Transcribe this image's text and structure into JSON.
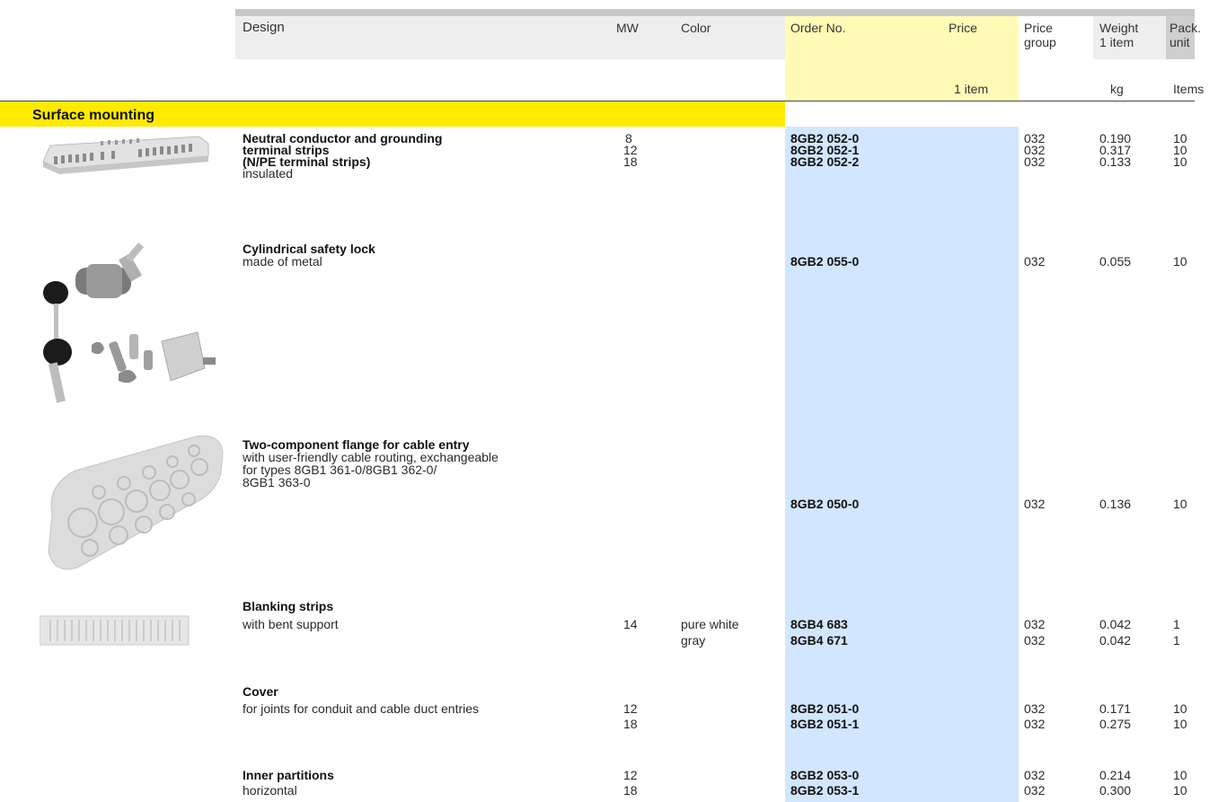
{
  "header": {
    "design": "Design",
    "mw": "MW",
    "color": "Color",
    "order_no": "Order No.",
    "price": "Price",
    "price_unit": "1 item",
    "price_group_1": "Price",
    "price_group_2": "group",
    "weight_1": "Weight",
    "weight_2": "1 item",
    "weight_unit": "kg",
    "pack_1": "Pack.",
    "pack_2": "unit",
    "pack_unit": "Items"
  },
  "section": {
    "title": "Surface mounting"
  },
  "products": [
    {
      "title_lines": [
        "Neutral conductor and grounding",
        "terminal strips",
        "(N/PE terminal strips)"
      ],
      "desc_lines": [
        "insulated"
      ],
      "image": "terminal-strip-image",
      "rows": [
        {
          "mw": "8",
          "color": "",
          "order": "8GB2 052-0",
          "group": "032",
          "weight": "0.190",
          "pack": "10"
        },
        {
          "mw": "12",
          "color": "",
          "order": "8GB2 052-1",
          "group": "032",
          "weight": "0.317",
          "pack": "10"
        },
        {
          "mw": "18",
          "color": "",
          "order": "8GB2 052-2",
          "group": "032",
          "weight": "0.133",
          "pack": "10"
        }
      ]
    },
    {
      "title_lines": [
        "Cylindrical safety lock"
      ],
      "desc_lines": [
        "made of metal"
      ],
      "image": "safety-lock-image",
      "rows": [
        {
          "mw": "",
          "color": "",
          "order": "8GB2 055-0",
          "group": "032",
          "weight": "0.055",
          "pack": "10"
        }
      ]
    },
    {
      "title_lines": [
        "Two-component flange for cable entry"
      ],
      "desc_lines": [
        "with user-friendly cable routing, exchangeable",
        "for types 8GB1 361-0/8GB1 362-0/",
        "8GB1 363-0"
      ],
      "image": "flange-image",
      "rows": [
        {
          "mw": "",
          "color": "",
          "order": "8GB2 050-0",
          "group": "032",
          "weight": "0.136",
          "pack": "10"
        }
      ]
    },
    {
      "title_lines": [
        "Blanking strips"
      ],
      "desc_lines": [
        "with bent support"
      ],
      "image": "blanking-strip-image",
      "rows": [
        {
          "mw": "14",
          "color": "pure white",
          "order": "8GB4 683",
          "group": "032",
          "weight": "0.042",
          "pack": "1"
        },
        {
          "mw": "",
          "color": "gray",
          "order": "8GB4 671",
          "group": "032",
          "weight": "0.042",
          "pack": "1"
        }
      ]
    },
    {
      "title_lines": [
        "Cover"
      ],
      "desc_lines": [
        "for joints for conduit and cable duct entries"
      ],
      "rows": [
        {
          "mw": "12",
          "color": "",
          "order": "8GB2 051-0",
          "group": "032",
          "weight": "0.171",
          "pack": "10"
        },
        {
          "mw": "18",
          "color": "",
          "order": "8GB2 051-1",
          "group": "032",
          "weight": "0.275",
          "pack": "10"
        }
      ]
    },
    {
      "title_lines": [
        "Inner partitions"
      ],
      "desc_lines": [
        "horizontal"
      ],
      "rows": [
        {
          "mw": "12",
          "color": "",
          "order": "8GB2 053-0",
          "group": "032",
          "weight": "0.214",
          "pack": "10"
        },
        {
          "mw": "18",
          "color": "",
          "order": "8GB2 053-1",
          "group": "032",
          "weight": "0.300",
          "pack": "10"
        }
      ]
    }
  ]
}
